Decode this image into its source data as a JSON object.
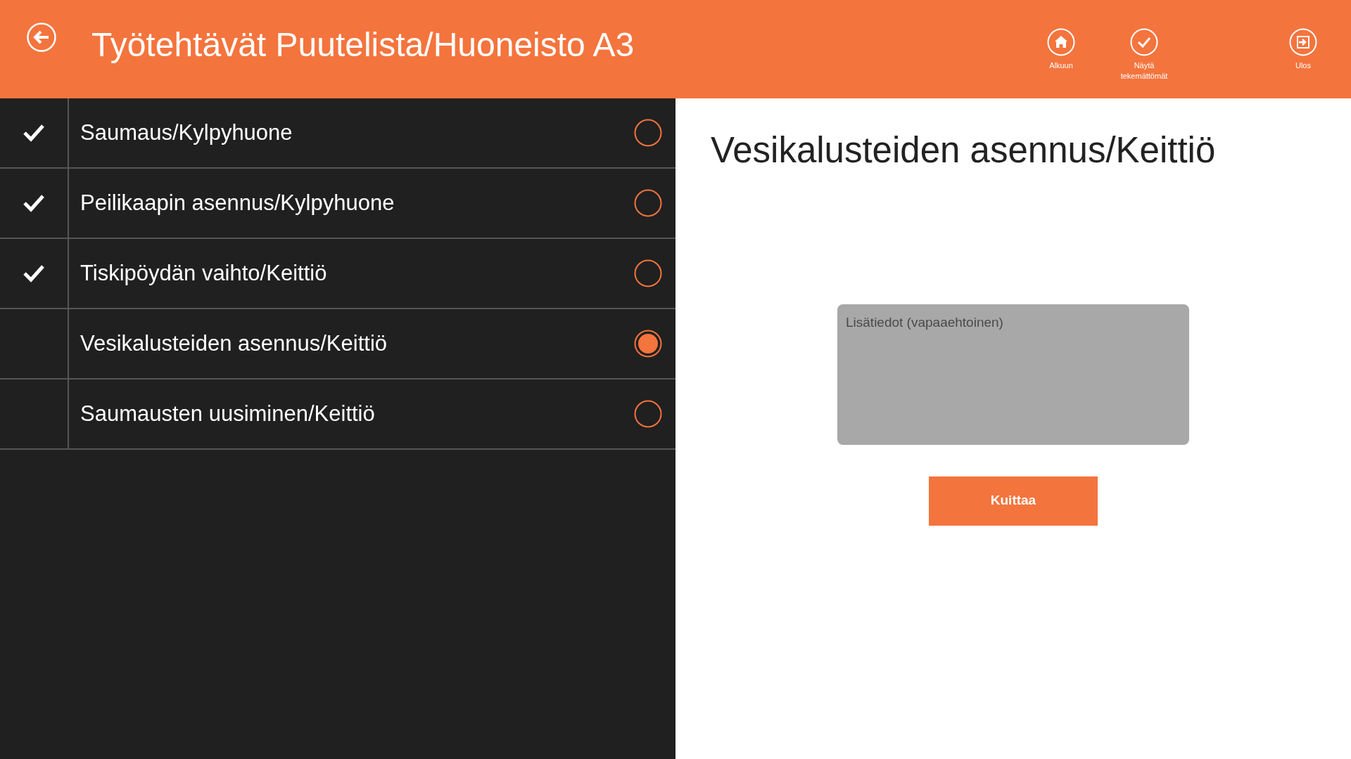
{
  "header": {
    "title": "Työtehtävät Puutelista/Huoneisto A3",
    "actions": [
      {
        "label": "Alkuun",
        "kind": "home"
      },
      {
        "label": "Näytä tekemättömät",
        "kind": "check"
      },
      {
        "label": "Ulos",
        "kind": "exit"
      }
    ]
  },
  "tasks": [
    {
      "label": "Saumaus/Kylpyhuone",
      "done": true,
      "selected": false
    },
    {
      "label": "Peilikaapin asennus/Kylpyhuone",
      "done": true,
      "selected": false
    },
    {
      "label": "Tiskipöydän vaihto/Keittiö",
      "done": true,
      "selected": false
    },
    {
      "label": "Vesikalusteiden asennus/Keittiö",
      "done": false,
      "selected": true
    },
    {
      "label": "Saumausten uusiminen/Keittiö",
      "done": false,
      "selected": false
    }
  ],
  "detail": {
    "title": "Vesikalusteiden asennus/Keittiö",
    "notes": {
      "placeholder": "Lisätiedot (vapaaehtoinen)"
    },
    "button": "Kuittaa"
  }
}
